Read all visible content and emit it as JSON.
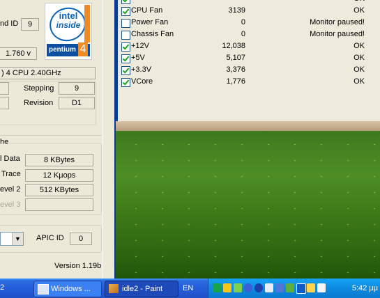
{
  "cpuz": {
    "brand_id_label": "nd ID",
    "brand_id_value": "9",
    "voltage_value": "1.760 v",
    "spec_value": ") 4 CPU 2.40GHz",
    "stepping_label": "Stepping",
    "stepping_value": "9",
    "revision_label": "Revision",
    "revision_value": "D1",
    "cache_section_label": "he",
    "l1_data_label": "l Data",
    "l1_data_value": "8 KBytes",
    "trace_label": "Trace",
    "trace_value": "12 Kμops",
    "level2_label": "evel 2",
    "level2_value": "512 KBytes",
    "level3_label": "evel 3",
    "level3_value": "",
    "apic_label": "APIC ID",
    "apic_value": "0",
    "version_label": "Version 1.19b",
    "logo": {
      "word": "intel",
      "inside": "inside",
      "product": "pentium",
      "product_num": "4"
    }
  },
  "monitor": {
    "rows": [
      {
        "name": "CPU Fan",
        "value": "3139",
        "status": "OK",
        "checked": true
      },
      {
        "name": "Power Fan",
        "value": "0",
        "status": "Monitor paused!",
        "checked": false
      },
      {
        "name": "Chassis Fan",
        "value": "0",
        "status": "Monitor paused!",
        "checked": false
      },
      {
        "name": "+12V",
        "value": "12,038",
        "status": "OK",
        "checked": true
      },
      {
        "name": "+5V",
        "value": "5,107",
        "status": "OK",
        "checked": true
      },
      {
        "name": "+3.3V",
        "value": "3,376",
        "status": "OK",
        "checked": true
      },
      {
        "name": "VCore",
        "value": "1,776",
        "status": "OK",
        "checked": true
      }
    ]
  },
  "taskbar": {
    "start_fragment": "2",
    "tasks": [
      {
        "label": "Windows ...",
        "active": false
      },
      {
        "label": "idle2 - Paint",
        "active": true
      }
    ],
    "language": "EN",
    "clock": "5:42 μμ",
    "tray_icons": [
      "green-app-icon",
      "zonealarm-icon",
      "network-icon",
      "globe-icon",
      "media-icon",
      "speaker-icon",
      "network-connection-icon",
      "gpu-icon",
      "arrow-icon",
      "display-icon",
      "user-icon"
    ],
    "colors": {
      "taskbar": "#245DDB",
      "tray": "#0E8AE0",
      "accent": "#0A64B7"
    }
  }
}
